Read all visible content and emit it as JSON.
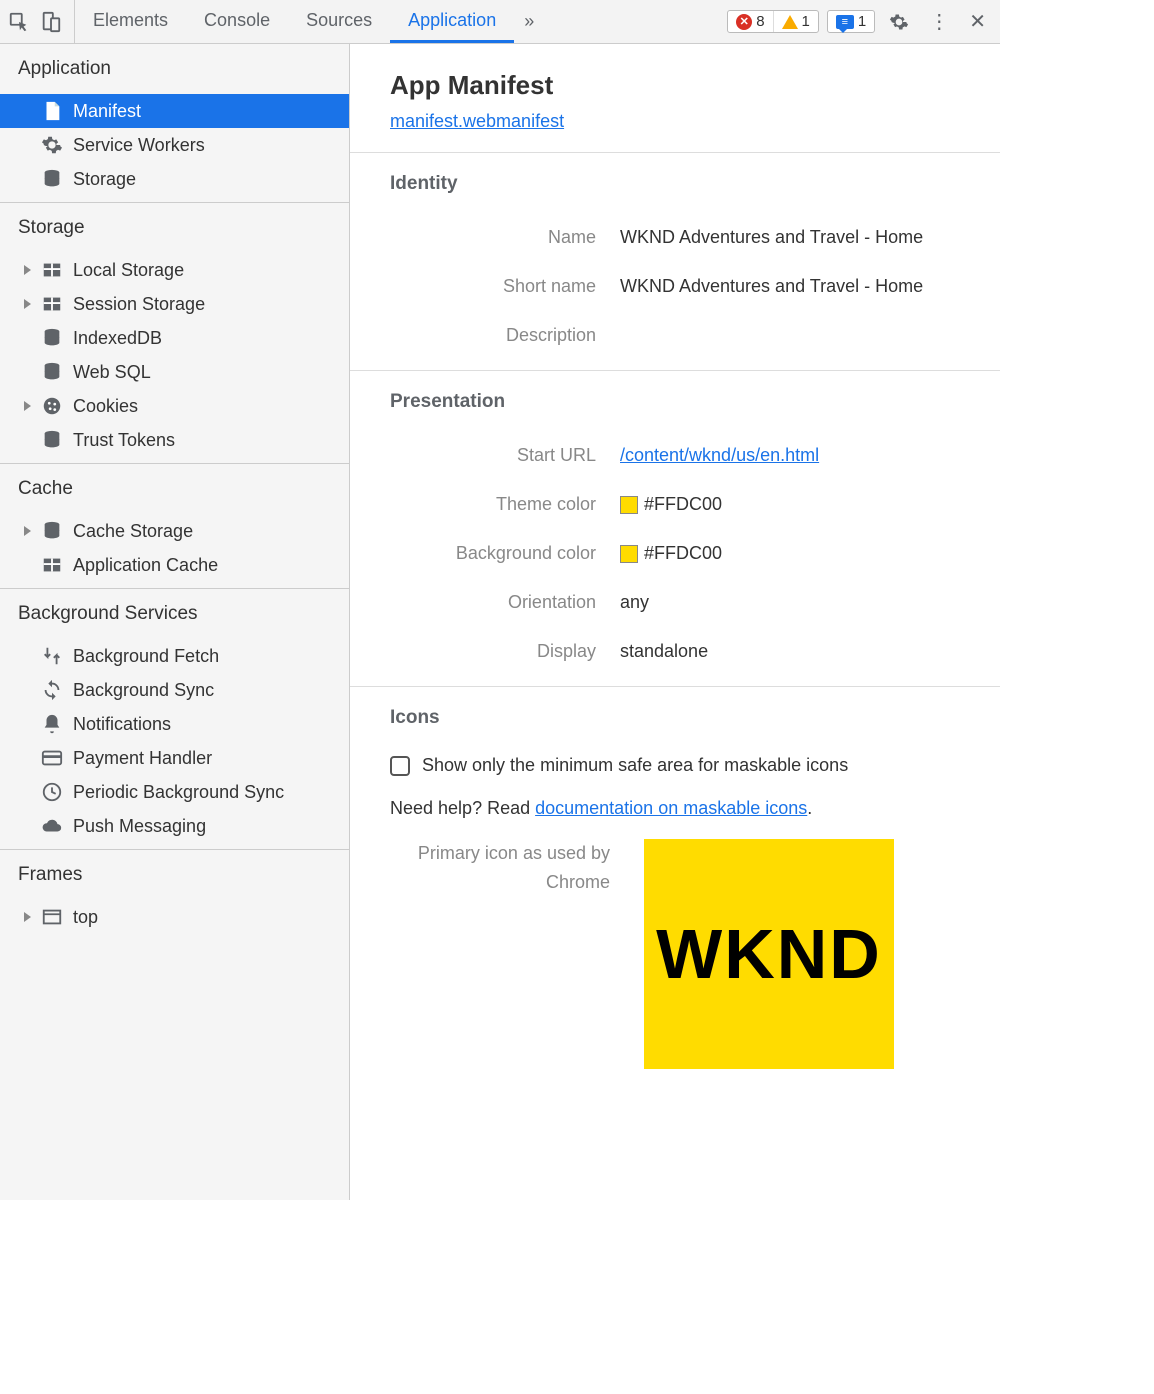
{
  "toolbar": {
    "tabs": [
      "Elements",
      "Console",
      "Sources",
      "Application"
    ],
    "active_tab": "Application",
    "error_count": "8",
    "warning_count": "1",
    "message_count": "1"
  },
  "sidebar": {
    "sections": [
      {
        "header": "Application",
        "items": [
          {
            "label": "Manifest",
            "icon": "document-icon",
            "active": true
          },
          {
            "label": "Service Workers",
            "icon": "gear-icon"
          },
          {
            "label": "Storage",
            "icon": "database-icon"
          }
        ]
      },
      {
        "header": "Storage",
        "items": [
          {
            "label": "Local Storage",
            "icon": "table-icon",
            "expandable": true
          },
          {
            "label": "Session Storage",
            "icon": "table-icon",
            "expandable": true
          },
          {
            "label": "IndexedDB",
            "icon": "database-icon"
          },
          {
            "label": "Web SQL",
            "icon": "database-icon"
          },
          {
            "label": "Cookies",
            "icon": "cookie-icon",
            "expandable": true
          },
          {
            "label": "Trust Tokens",
            "icon": "database-icon"
          }
        ]
      },
      {
        "header": "Cache",
        "items": [
          {
            "label": "Cache Storage",
            "icon": "database-icon",
            "expandable": true
          },
          {
            "label": "Application Cache",
            "icon": "table-icon"
          }
        ]
      },
      {
        "header": "Background Services",
        "items": [
          {
            "label": "Background Fetch",
            "icon": "fetch-icon"
          },
          {
            "label": "Background Sync",
            "icon": "sync-icon"
          },
          {
            "label": "Notifications",
            "icon": "bell-icon"
          },
          {
            "label": "Payment Handler",
            "icon": "card-icon"
          },
          {
            "label": "Periodic Background Sync",
            "icon": "clock-icon"
          },
          {
            "label": "Push Messaging",
            "icon": "cloud-icon"
          }
        ]
      },
      {
        "header": "Frames",
        "items": [
          {
            "label": "top",
            "icon": "window-icon",
            "expandable": true
          }
        ]
      }
    ]
  },
  "main": {
    "title": "App Manifest",
    "manifest_link": "manifest.webmanifest",
    "identity": {
      "header": "Identity",
      "name_label": "Name",
      "name_value": "WKND Adventures and Travel - Home",
      "short_name_label": "Short name",
      "short_name_value": "WKND Adventures and Travel - Home",
      "description_label": "Description",
      "description_value": ""
    },
    "presentation": {
      "header": "Presentation",
      "start_url_label": "Start URL",
      "start_url_value": "/content/wknd/us/en.html",
      "theme_color_label": "Theme color",
      "theme_color_value": "#FFDC00",
      "bg_color_label": "Background color",
      "bg_color_value": "#FFDC00",
      "orientation_label": "Orientation",
      "orientation_value": "any",
      "display_label": "Display",
      "display_value": "standalone"
    },
    "icons": {
      "header": "Icons",
      "checkbox_label": "Show only the minimum safe area for maskable icons",
      "help_prefix": "Need help? Read ",
      "help_link": "documentation on maskable icons",
      "help_suffix": ".",
      "preview_label": "Primary icon as used by Chrome",
      "preview_text": "WKND",
      "preview_bg": "#FFDC00"
    }
  }
}
